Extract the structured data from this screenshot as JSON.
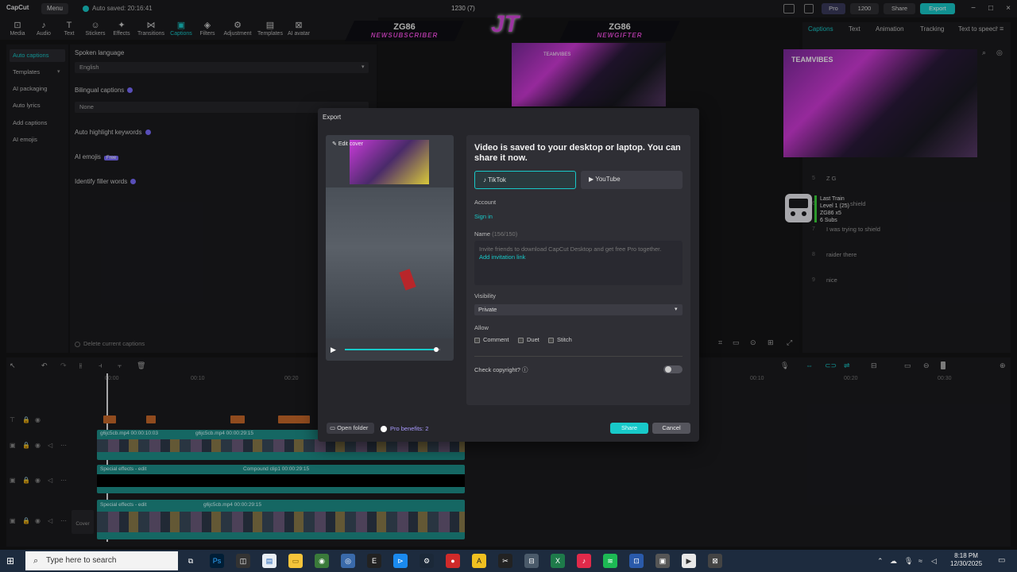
{
  "app": {
    "name": "CapCut",
    "menu_label": "Menu",
    "autosave": "Auto saved: 20:16:41",
    "project_title": "1230 (7)",
    "pro_label": "Pro",
    "credits": "1200",
    "share_label": "Share",
    "export_label": "Export"
  },
  "toolbar": {
    "items": [
      {
        "label": "Media",
        "icon": "media-icon"
      },
      {
        "label": "Audio",
        "icon": "audio-icon"
      },
      {
        "label": "Text",
        "icon": "text-icon"
      },
      {
        "label": "Stickers",
        "icon": "stickers-icon"
      },
      {
        "label": "Effects",
        "icon": "effects-icon"
      },
      {
        "label": "Transitions",
        "icon": "transitions-icon"
      },
      {
        "label": "Captions",
        "icon": "captions-icon"
      },
      {
        "label": "Filters",
        "icon": "filters-icon"
      },
      {
        "label": "Adjustment",
        "icon": "adjustment-icon"
      },
      {
        "label": "Templates",
        "icon": "templates-icon"
      },
      {
        "label": "AI avatar",
        "icon": "ai-avatar-icon"
      }
    ],
    "active": "Captions"
  },
  "caption_nav": {
    "items": [
      "Auto captions",
      "Templates",
      "AI packaging",
      "Auto lyrics",
      "Add captions",
      "AI emojis"
    ],
    "active": "Auto captions"
  },
  "caption_settings": {
    "spoken_language_label": "Spoken language",
    "spoken_language_value": "English",
    "bilingual_label": "Bilingual captions",
    "bilingual_value": "None",
    "highlight_label": "Auto highlight keywords",
    "ai_emojis_label": "AI emojis",
    "ai_emojis_badge": "Free",
    "filler_label": "Identify filler words",
    "delete_label": "Delete current captions"
  },
  "stream_overlay": {
    "left_banner_name": "ZG86",
    "left_banner_sub": "NEWSUBSCRIBER",
    "right_banner_name": "ZG86",
    "right_banner_sub": "NEWGIFTER",
    "logo": "JT",
    "webcam_label": "TEAMVIBES",
    "alert_title": "Last Train",
    "alert_level": "Level 1 (25)",
    "alert_user": "ZG86 x5",
    "alert_subs": "6 Subs"
  },
  "right_panel": {
    "tabs": [
      "Captions",
      "Text",
      "Animation",
      "Tracking",
      "Text to speech"
    ],
    "active": "Captions",
    "caption_lines": [
      {
        "num": "5",
        "text": "Z G"
      },
      {
        "num": "6",
        "text": "shield"
      },
      {
        "num": "7",
        "text": "I was trying to shield"
      },
      {
        "num": "8",
        "text": "raider there"
      },
      {
        "num": "9",
        "text": "nice"
      }
    ]
  },
  "export_dialog": {
    "title": "Export",
    "edit_cover": "Edit cover",
    "message": "Video is saved to your desktop or laptop. You can share it now.",
    "platforms": [
      "TikTok",
      "YouTube"
    ],
    "selected_platform": "TikTok",
    "account_label": "Account",
    "sign_in": "Sign in",
    "name_label": "Name",
    "name_count": "(156/150)",
    "name_placeholder": "Invite friends to download CapCut Desktop and get free Pro together.",
    "invite_link": "Add invitation link",
    "visibility_label": "Visibility",
    "visibility_value": "Private",
    "allow_label": "Allow",
    "allow_options": [
      "Comment",
      "Duet",
      "Stitch"
    ],
    "copyright_label": "Check copyright?",
    "open_folder": "Open folder",
    "pro_benefits": "Pro benefits: 2",
    "share_button": "Share",
    "cancel_button": "Cancel",
    "progress": 0.96
  },
  "timeline": {
    "ruler": [
      "00:00",
      "00:10",
      "00:20",
      "00:10",
      "00:20",
      "00:30"
    ],
    "clips": {
      "video1": "g6jc5cb.mp4  00:00:10:03",
      "video1b": "g6jc5cb.mp4  00:00:29:15",
      "effects1": "Special effects - edit",
      "compound": "Compound clip1  00:00:29:15",
      "effects2": "Special effects - edit",
      "video2": "g6jc5cb.mp4  00:00:29:15",
      "cover_label": "Cover"
    }
  },
  "taskbar": {
    "search_placeholder": "Type here to search",
    "time": "8:18 PM",
    "date": "12/30/2025"
  },
  "colors": {
    "accent": "#18c9c9",
    "panel": "#1b1b1e",
    "dialog": "#26262b",
    "taskbar": "#1d2b3e"
  }
}
